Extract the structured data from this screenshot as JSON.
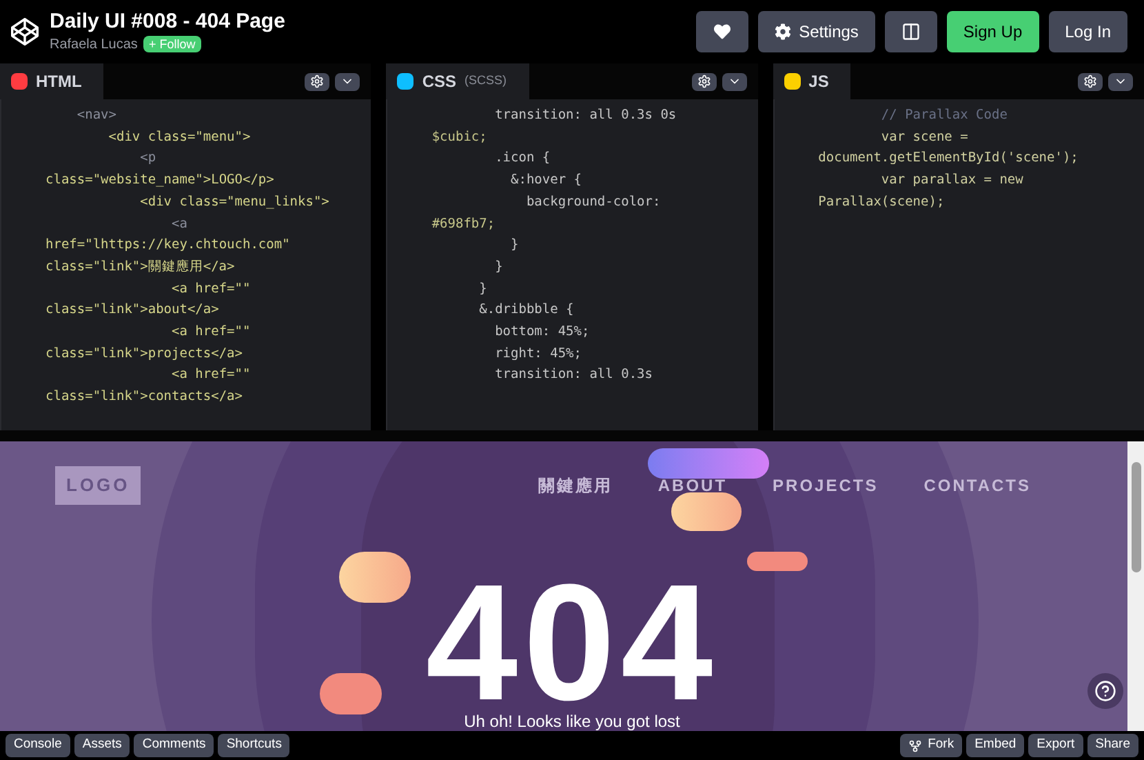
{
  "header": {
    "title": "Daily UI #008 - 404 Page",
    "author": "Rafaela Lucas",
    "follow": "+ Follow",
    "buttons": [
      {
        "kind": "heart"
      },
      {
        "kind": "settings",
        "label": "Settings"
      },
      {
        "kind": "layout"
      },
      {
        "kind": "signup",
        "label": "Sign Up"
      },
      {
        "kind": "login",
        "label": "Log In"
      }
    ]
  },
  "editors": [
    {
      "kind": "html",
      "name": "HTML",
      "lines": [
        "    <nav>",
        "        <div class=\"menu\">",
        "            <p",
        "class=\"website_name\">LOGO</p>",
        "            <div class=\"menu_links\">",
        "                <a",
        "href=\"lhttps://key.chtouch.com\"",
        "class=\"link\">關鍵應用</a>",
        "                <a href=\"\"",
        "class=\"link\">about</a>",
        "                <a href=\"\"",
        "class=\"link\">projects</a>",
        "                <a href=\"\"",
        "class=\"link\">contacts</a>"
      ]
    },
    {
      "kind": "css",
      "name": "CSS",
      "sub": "(SCSS)",
      "lines": [
        "        transition: all 0.3s 0s",
        "$cubic;",
        "        .icon {",
        "          &:hover {",
        "            background-color:",
        "#698fb7;",
        "          }",
        "        }",
        "      }",
        "      &.dribbble {",
        "        bottom: 45%;",
        "        right: 45%;",
        "        transition: all 0.3s"
      ]
    },
    {
      "kind": "js",
      "name": "JS",
      "lines": [
        "        // Parallax Code",
        "        var scene =",
        "document.getElementById('scene');",
        "        var parallax = new",
        "Parallax(scene);"
      ]
    }
  ],
  "preview": {
    "logo": "LOGO",
    "nav": [
      "關鍵應用",
      "ABOUT",
      "PROJECTS",
      "CONTACTS"
    ],
    "code": "404",
    "message": "Uh oh! Looks like you got lost"
  },
  "footer": {
    "left": [
      "Console",
      "Assets",
      "Comments",
      "Shortcuts"
    ],
    "right": [
      "Fork",
      "Embed",
      "Export",
      "Share"
    ]
  }
}
